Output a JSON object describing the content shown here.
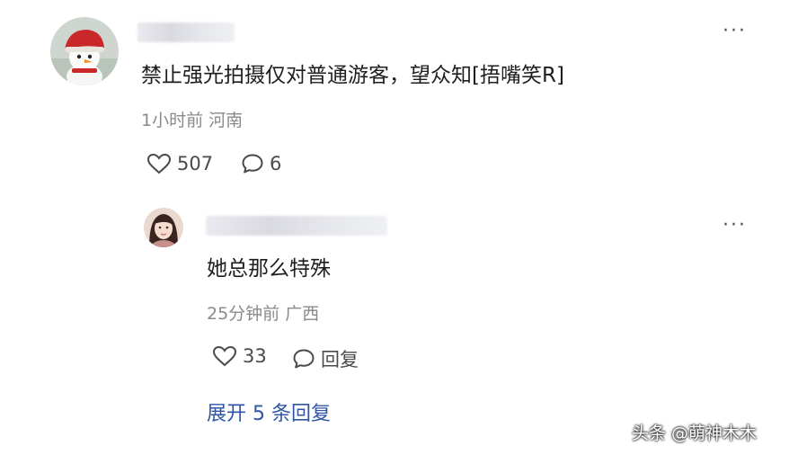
{
  "comment": {
    "text": "禁止强光拍摄仅对普通游客，望众知[捂嘴笑R]",
    "time": "1小时前",
    "location": "河南",
    "likes": "507",
    "replies": "6",
    "more": "···"
  },
  "reply": {
    "text": "她总那么特殊",
    "time": "25分钟前",
    "location": "广西",
    "likes": "33",
    "reply_label": "回复",
    "more": "···"
  },
  "expand_label": "展开 5 条回复",
  "watermark": "头条 @萌神木木",
  "colors": {
    "link": "#2f56a6",
    "meta": "#8a8a8a",
    "text": "#1e1e1e"
  },
  "icons": [
    "heart-icon",
    "comment-bubble-icon",
    "more-dots-icon",
    "snowman-avatar",
    "user-avatar"
  ]
}
